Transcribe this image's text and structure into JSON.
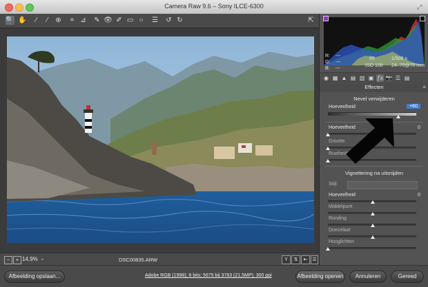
{
  "window": {
    "title": "Camera Raw 9.6  –  Sony ILCE-6300"
  },
  "toolbar": {
    "tools": [
      "zoom-icon",
      "hand-icon",
      "white-balance-icon",
      "color-sampler-icon",
      "target-adjust-icon",
      "crop-icon",
      "straighten-icon",
      "spot-removal-icon",
      "red-eye-icon",
      "adjustment-brush-icon",
      "graduated-filter-icon",
      "radial-filter-icon",
      "preferences-icon",
      "rotate-left-icon",
      "rotate-right-icon"
    ],
    "fullscreen": "fullscreen-icon"
  },
  "photo": {
    "description_alt": "DSC00835.ARW"
  },
  "bottom": {
    "zoom_out": "−",
    "zoom_in": "+",
    "zoom_level": "14,9%",
    "filename": "DSC00835.ARW",
    "view_y": "Y"
  },
  "readouts": {
    "r_label": "R:",
    "r_value": "---",
    "g_label": "G:",
    "g_value": "---",
    "b_label": "B:",
    "b_value": "---",
    "aperture": "f/5",
    "shutter": "1/500 s",
    "iso": "ISO 100",
    "lens": "24–70@70 mm"
  },
  "panel": {
    "title": "Effecten",
    "sections": {
      "dehaze": {
        "title": "Nevel verwijderen",
        "amount_label": "Hoeveelheid",
        "amount_value": "+60",
        "amount_level": 0.8
      },
      "grain": {
        "amount_label": "Hoeveelheid",
        "amount_value": "0",
        "size_label": "Grootte",
        "roughness_label": "Ruwheid"
      },
      "vignette": {
        "title": "Vignettering na uitsnijden",
        "style_label": "Stijl:",
        "amount_label": "Hoeveelheid",
        "amount_value": "0",
        "midpoint_label": "Middelpunt",
        "roundness_label": "Ronding",
        "feather_label": "Doezelaar",
        "highlights_label": "Hooglichten"
      }
    }
  },
  "footer": {
    "save_label": "Afbeelding opslaan...",
    "workflow_link": "Adobe RGB (1998); 8 bits; 5675 bij 3783 (21,5MP); 300 ppi",
    "open_label": "Afbeelding openen",
    "cancel_label": "Annuleren",
    "done_label": "Gereed"
  },
  "colors": {
    "panel": "#535353",
    "canvas": "#3b3b3b",
    "highlight": "#3f7ed6"
  }
}
